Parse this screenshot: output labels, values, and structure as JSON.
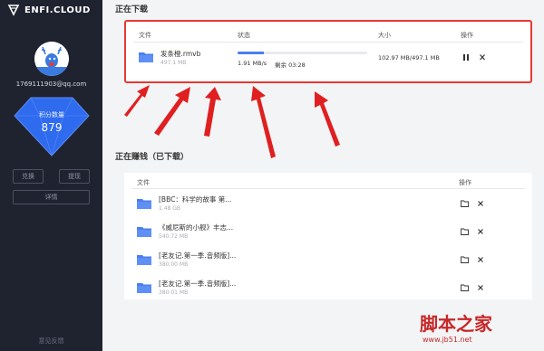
{
  "sidebar": {
    "brand": "ENFI.CLOUD",
    "email": "1769111903@qq.com",
    "points_label": "积分数量",
    "points_value": "879",
    "button_a": "兑换",
    "button_b": "提现",
    "button_c": "详情",
    "footer": "意见反馈"
  },
  "downloading": {
    "title": "正在下载",
    "headers": {
      "file": "文件",
      "status": "状态",
      "size": "大小",
      "actions": "操作"
    },
    "item": {
      "name": "发条橙.rmvb",
      "file_size": "497.1 MB",
      "progress": 0.2,
      "speed": "1.91 MB/s",
      "remaining": "剩余 03:28",
      "size_progress": "102.97 MB/497.1 MB"
    }
  },
  "earning": {
    "title": "正在赚钱（已下载）",
    "headers": {
      "file": "文件",
      "actions": "操作"
    },
    "items": [
      {
        "name": "[BBC：科学的故事 第...",
        "size": "1.48 GB"
      },
      {
        "name": "《威尼斯的小舰》丰志...",
        "size": "540.72 MB"
      },
      {
        "name": "[老友记.第一季.音频版]...",
        "size": "380.00 MB"
      },
      {
        "name": "[老友记.第一季.音频版]...",
        "size": "380.01 MB"
      }
    ]
  },
  "watermark": {
    "title": "脚本之家",
    "url": "www.jb51.net"
  },
  "colors": {
    "sidebar_bg": "#1f2330",
    "accent": "#4a7ef0",
    "highlight": "#e53935",
    "diamond": "#2f6bef"
  }
}
